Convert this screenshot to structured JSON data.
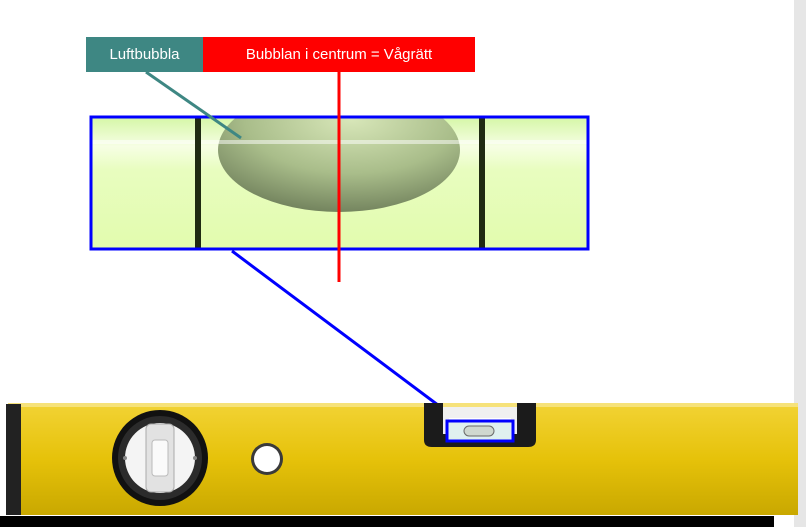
{
  "labels": {
    "bubble": "Luftbubbla",
    "center": "Bubblan i centrum = Vågrätt"
  },
  "colors": {
    "bubble_label_bg": "#3e8783",
    "center_label_bg": "#ff0000",
    "highlight_box": "#0000ff",
    "vial_liquid": "#e3fbb6",
    "level_body": "#e6c20a"
  },
  "icons": [
    "bubble-vial-icon",
    "rotating-vial-icon",
    "hanging-hole-icon"
  ]
}
